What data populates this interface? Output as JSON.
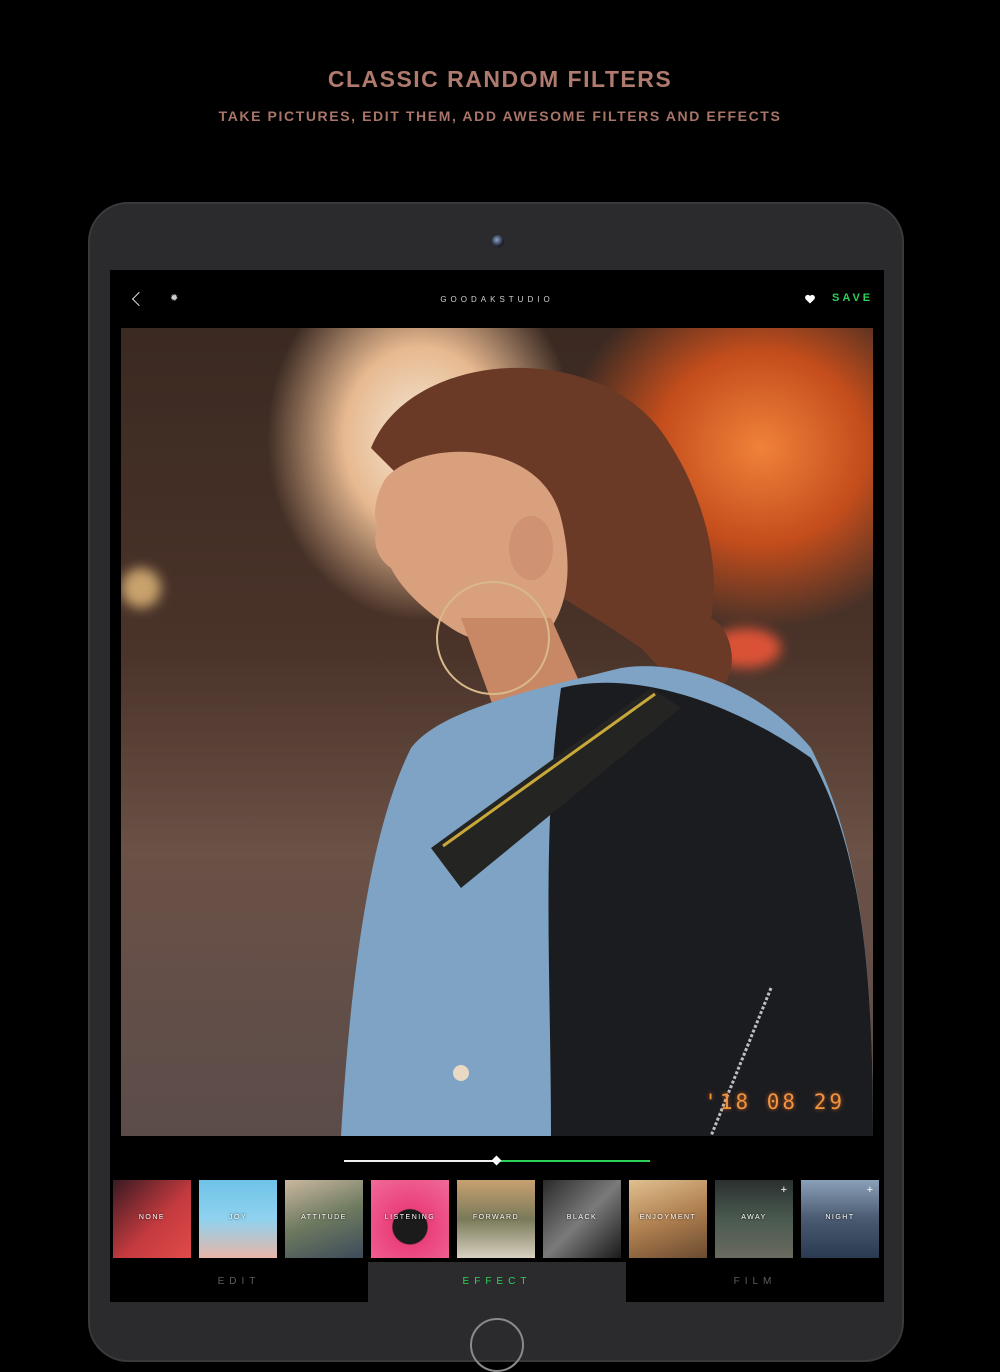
{
  "marketing": {
    "headline": "CLASSIC RANDOM FILTERS",
    "subline": "TAKE PICTURES, EDIT THEM, ADD AWESOME FILTERS AND EFFECTS"
  },
  "toolbar": {
    "title": "GOODAKSTUDIO",
    "save_label": "SAVE",
    "accent_color": "#2ed158"
  },
  "photo": {
    "date_stamp": "'18 08 29"
  },
  "slider": {
    "value": 0.5
  },
  "filters": [
    {
      "label": "NONE",
      "plus": false
    },
    {
      "label": "JOY",
      "plus": false
    },
    {
      "label": "ATTITUDE",
      "plus": false
    },
    {
      "label": "LISTENING",
      "plus": false
    },
    {
      "label": "FORWARD",
      "plus": false
    },
    {
      "label": "BLACK",
      "plus": false
    },
    {
      "label": "ENJOYMENT",
      "plus": false
    },
    {
      "label": "AWAY",
      "plus": true
    },
    {
      "label": "NIGHT",
      "plus": true
    }
  ],
  "tabs": [
    {
      "label": "EDIT",
      "active": false
    },
    {
      "label": "EFFECT",
      "active": true
    },
    {
      "label": "FILM",
      "active": false
    }
  ]
}
